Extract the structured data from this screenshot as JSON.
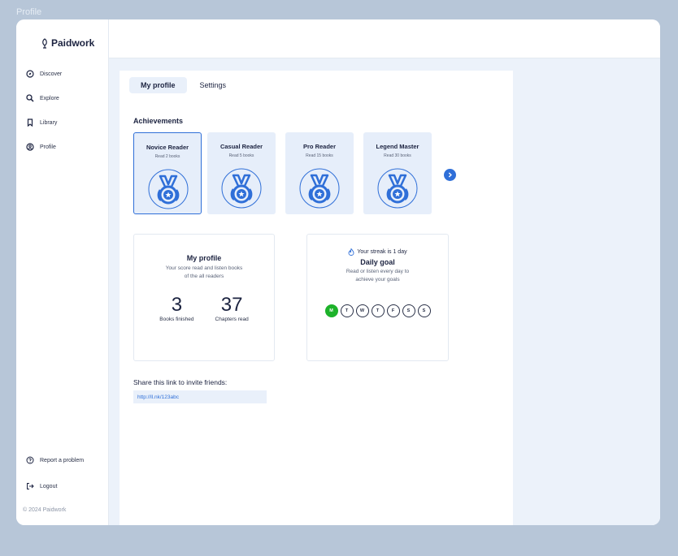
{
  "page_label": "Profile",
  "brand": {
    "name": "Paidwork"
  },
  "sidebar": {
    "items": [
      {
        "label": "Discover",
        "icon": "compass-icon"
      },
      {
        "label": "Explore",
        "icon": "search-icon"
      },
      {
        "label": "Library",
        "icon": "bookmark-icon"
      },
      {
        "label": "Profile",
        "icon": "user-circle-icon"
      }
    ],
    "bottom_items": [
      {
        "label": "Report a problem",
        "icon": "help-circle-icon"
      },
      {
        "label": "Logout",
        "icon": "logout-icon"
      }
    ],
    "copyright": "© 2024 Paidwork"
  },
  "tabs": [
    {
      "label": "My profile",
      "active": true
    },
    {
      "label": "Settings",
      "active": false
    }
  ],
  "achievements": {
    "title": "Achievements",
    "items": [
      {
        "title": "Novice Reader",
        "subtitle": "Read 2 books",
        "selected": true
      },
      {
        "title": "Casual Reader",
        "subtitle": "Read 5 books",
        "selected": false
      },
      {
        "title": "Pro Reader",
        "subtitle": "Read 15 books",
        "selected": false
      },
      {
        "title": "Legend Master",
        "subtitle": "Read 30 books",
        "selected": false
      }
    ]
  },
  "profile_card": {
    "title": "My profile",
    "subtitle_line1": "Your score read and listen books",
    "subtitle_line2": "of the all readers",
    "stats": [
      {
        "value": "3",
        "label": "Books finished"
      },
      {
        "value": "37",
        "label": "Chapters read"
      }
    ]
  },
  "goal_card": {
    "streak": "Your streak is 1 day",
    "title": "Daily goal",
    "subtitle_line1": "Read or listen every day to",
    "subtitle_line2": "achieve your goals",
    "days": [
      {
        "label": "M",
        "active": true
      },
      {
        "label": "T",
        "active": false
      },
      {
        "label": "W",
        "active": false
      },
      {
        "label": "T",
        "active": false
      },
      {
        "label": "F",
        "active": false
      },
      {
        "label": "S",
        "active": false
      },
      {
        "label": "S",
        "active": false
      }
    ]
  },
  "share": {
    "label": "Share this link to invite friends:",
    "link": "http://ll.nk/123abc"
  },
  "colors": {
    "accent": "#2f6fd8",
    "active_day": "#1db22a",
    "background": "#b7c6d8",
    "content_bg": "#ecf2fa"
  }
}
